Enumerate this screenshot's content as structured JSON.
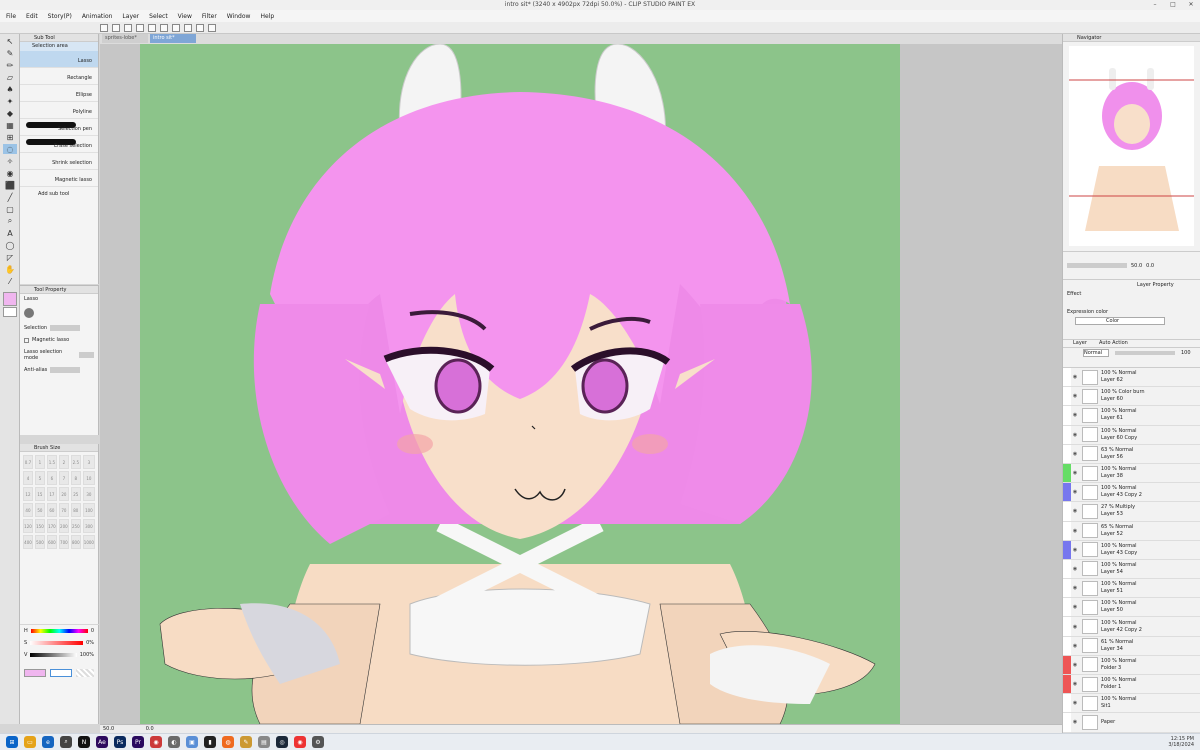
{
  "window": {
    "title": "intro sit* (3240 x 4902px 72dpi 50.0%) - CLIP STUDIO PAINT EX"
  },
  "menu": [
    "File",
    "Edit",
    "Story(P)",
    "Animation",
    "Layer",
    "Select",
    "View",
    "Filter",
    "Window",
    "Help"
  ],
  "tabs": [
    "sprites-lobe*",
    "intro sit*"
  ],
  "subtool": {
    "header": "Sub Tool",
    "group": "Selection area",
    "items": [
      "Lasso",
      "Rectangle",
      "Ellipse",
      "Polyline",
      "Selection pen",
      "Erase selection",
      "Shrink selection",
      "Magnetic lasso"
    ],
    "add": "Add sub tool"
  },
  "toolprop": {
    "header": "Tool Property",
    "name": "Lasso",
    "selection_label": "Selection",
    "magnetic": "Magnetic lasso",
    "mode_label": "Lasso selection mode",
    "antialias": "Anti-alias"
  },
  "brushsize": {
    "header": "Brush Size",
    "sizes": [
      "0.7",
      "1",
      "1.5",
      "2",
      "2.5",
      "3",
      "4",
      "5",
      "6",
      "7",
      "8",
      "10",
      "12",
      "15",
      "17",
      "20",
      "25",
      "30",
      "40",
      "50",
      "60",
      "70",
      "80",
      "100",
      "120",
      "150",
      "170",
      "200",
      "250",
      "300",
      "400",
      "500",
      "600",
      "700",
      "800",
      "1000"
    ]
  },
  "color": {
    "h_label": "H",
    "s_label": "S",
    "v_label": "V",
    "h": "0",
    "s": "0%",
    "v": "100%"
  },
  "statusbar": {
    "zoom": "50.0",
    "pos": "0.0"
  },
  "navigator": {
    "header": "Navigator",
    "zoom": "50.0",
    "rotate": "0.0"
  },
  "layerprop": {
    "tab1": "Layer Property",
    "effect": "Effect",
    "expr_label": "Expression color",
    "expr_value": "Color"
  },
  "layerpanel": {
    "tab1": "Layer",
    "tab2": "Auto Action",
    "blend": "Normal",
    "opacity": "100"
  },
  "layers": [
    {
      "meta": "100 % Normal",
      "name": "Layer 62",
      "color": "#ffffff"
    },
    {
      "meta": "100 % Color burn",
      "name": "Layer 60",
      "color": "#ffffff"
    },
    {
      "meta": "100 % Normal",
      "name": "Layer 61",
      "color": "#ffffff"
    },
    {
      "meta": "100 % Normal",
      "name": "Layer 60 Copy",
      "color": "#ffffff"
    },
    {
      "meta": "63 % Normal",
      "name": "Layer 56",
      "color": "#ffffff"
    },
    {
      "meta": "100 % Normal",
      "name": "Layer 38",
      "color": "#66dd66"
    },
    {
      "meta": "100 % Normal",
      "name": "Layer 43 Copy 2",
      "color": "#7777ee"
    },
    {
      "meta": "27 % Multiply",
      "name": "Layer 53",
      "color": "#ffffff"
    },
    {
      "meta": "65 % Normal",
      "name": "Layer 52",
      "color": "#ffffff"
    },
    {
      "meta": "100 % Normal",
      "name": "Layer 43 Copy",
      "color": "#7777ee"
    },
    {
      "meta": "100 % Normal",
      "name": "Layer 54",
      "color": "#ffffff"
    },
    {
      "meta": "100 % Normal",
      "name": "Layer 51",
      "color": "#ffffff"
    },
    {
      "meta": "100 % Normal",
      "name": "Layer 50",
      "color": "#ffffff"
    },
    {
      "meta": "100 % Normal",
      "name": "Layer 42 Copy 2",
      "color": "#ffffff"
    },
    {
      "meta": "61 % Normal",
      "name": "Layer 34",
      "color": "#ffffff"
    },
    {
      "meta": "100 % Normal",
      "name": "Folder 3",
      "color": "#ee5555"
    },
    {
      "meta": "100 % Normal",
      "name": "Folder 1",
      "color": "#ee5555"
    },
    {
      "meta": "100 % Normal",
      "name": "Sit1",
      "color": "#ffffff"
    },
    {
      "meta": "",
      "name": "Paper",
      "color": "#ffffff"
    }
  ],
  "taskbar": {
    "time": "12:15 PM",
    "date": "3/18/2024"
  },
  "colors": {
    "hair": "#f090ec",
    "skin": "#f7dcc4",
    "bg": "#8cc48a",
    "accent": "#9bc3e6"
  }
}
